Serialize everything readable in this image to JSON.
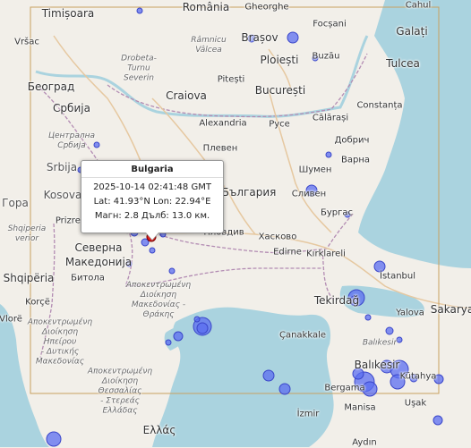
{
  "map": {
    "labels": {
      "timisoara": "Timișoara",
      "romania": "România",
      "gheorghe": "Gheorghe",
      "cahul": "Cahul",
      "focsani": "Focșani",
      "galati": "Galați",
      "vrsac": "Vršac",
      "brasov": "Brașov",
      "ramnicu": "Râmnicu\nVâlcea",
      "buzau": "Buzău",
      "drobeta": "Drobeta-\nTurnu\nSeverin",
      "pitesti": "Pitești",
      "ploiesti": "Ploiești",
      "tulcea": "Tulcea",
      "beograd": "Београд",
      "craiova": "Craiova",
      "bucuresti": "București",
      "srbija": "Србија",
      "alexandria": "Alexandria",
      "ruse": "Русе",
      "calarasi": "Călărași",
      "constanta": "Constanța",
      "centralna": "Централна\nСрбија",
      "pleven": "Плевен",
      "dobrich": "Добрич",
      "shumen": "Шумен",
      "varna": "Варна",
      "srbija2": "Srbija",
      "bulgaria": "България",
      "sliven": "Сливен",
      "kosovo": "Kosova",
      "gora": "Гора",
      "burgas": "Бургас",
      "prizren": "Prizren",
      "plovdiv": "Пловдив",
      "haskovo": "Хасково",
      "shqiperia_v": "Shqiperia\nverior",
      "sev_makedonija": "Северна\nМакедонија",
      "edirne": "Edirne",
      "kirklareli": "Kırklareli",
      "bitola": "Битола",
      "shqiperia": "Shqipëria",
      "istanbul": "İstanbul",
      "apokentr1": "Αποκεντρωμένη\nΔιοίκηση\nΜακεδονίας -\nΘράκης",
      "tekirdag": "Tekirdağ",
      "korce": "Korçë",
      "yalova": "Yalova",
      "sakarya": "Sakarya",
      "vlore": "Vlorë",
      "apokentr2": "Αποκεντρωμένη\nΔιοίκηση\nΗπείρου\n- Δυτικής\nΜακεδονίας",
      "canakkale": "Çanakkale",
      "balikesir_reg": "Balıkesir",
      "balikesir": "Balıkesir",
      "kutahya": "Kütahya",
      "apokentr3": "Αποκεντρωμένη\nΔιοίκηση\nΘεσσαλίας\n- Στερεάς\nΕλλάδας",
      "bergama": "Bergama",
      "manisa": "Manisa",
      "usak": "Uşak",
      "izmir": "İzmir",
      "ellas": "Ελλάς",
      "aydin": "Aydın",
      "bulgaria_region": "Bulgaria"
    }
  },
  "popup": {
    "title": "Bulgaria",
    "datetime": "2025-10-14 02:41:48 GMT",
    "latlon": "Lat: 41.93°N Lon: 22.94°E",
    "magdepth": "Магн: 2.8 Дълб: 13.0 км."
  },
  "colors": {
    "quake_fill": "#5b6ef0",
    "quake_stroke": "#3a46c9",
    "selected_quake": "#e02020",
    "bbox": "#c8a060"
  }
}
